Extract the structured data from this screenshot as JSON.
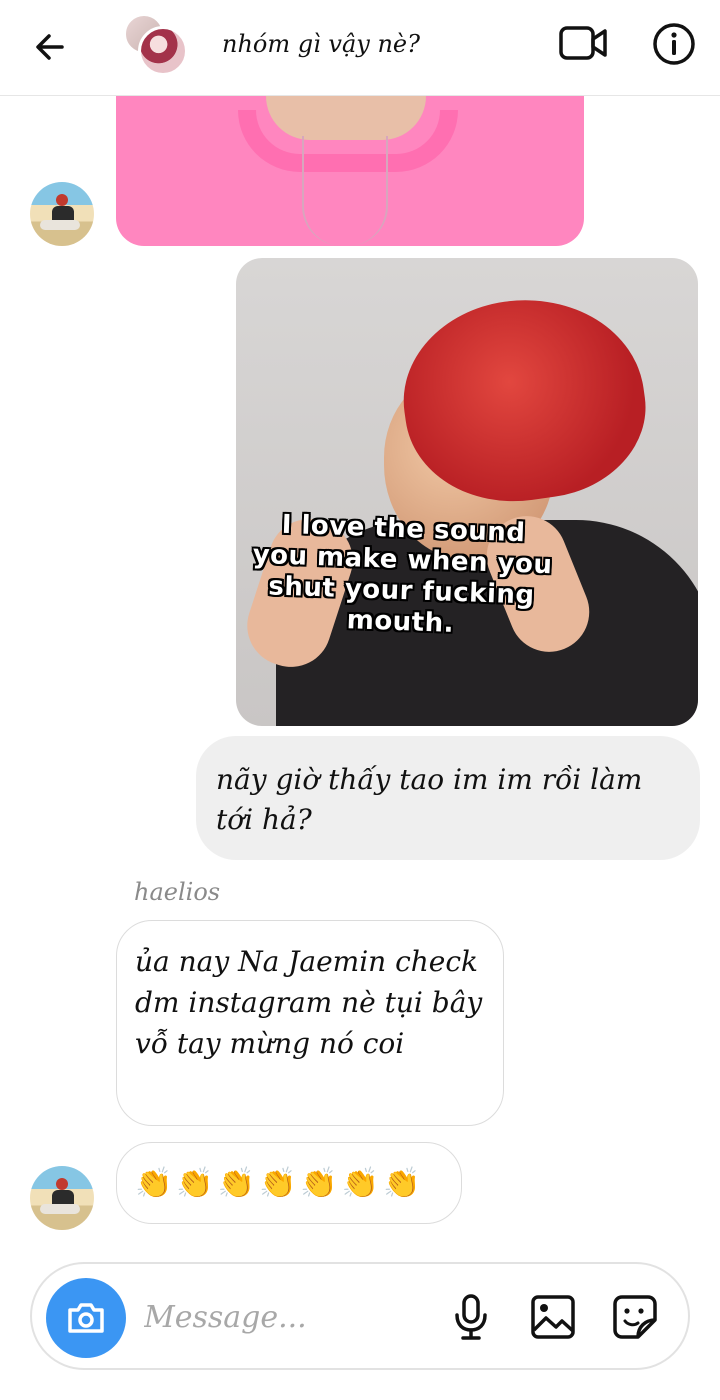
{
  "header": {
    "title": "nhóm gì vậy nè?",
    "back_icon": "arrow-left-icon",
    "video_icon": "video-camera-icon",
    "info_icon": "info-icon"
  },
  "messages": {
    "meme_caption": "I love the sound you make when you shut your fucking mouth.",
    "outgoing_text": "nãy giờ thấy tao im im rồi làm tới hả?",
    "sender_name": "haelios",
    "incoming_text": "ủa nay Na Jaemin check dm instagram nè tụi bây vỗ tay mừng nó coi",
    "incoming_emojis": "👏👏👏👏👏👏👏"
  },
  "composer": {
    "placeholder": "Message...",
    "camera_icon": "camera-icon",
    "mic_icon": "microphone-icon",
    "gallery_icon": "image-icon",
    "sticker_icon": "sticker-icon"
  },
  "colors": {
    "accent": "#3b96f3",
    "bubble_outgoing": "#efefef",
    "bubble_border": "#dcdcdc"
  }
}
